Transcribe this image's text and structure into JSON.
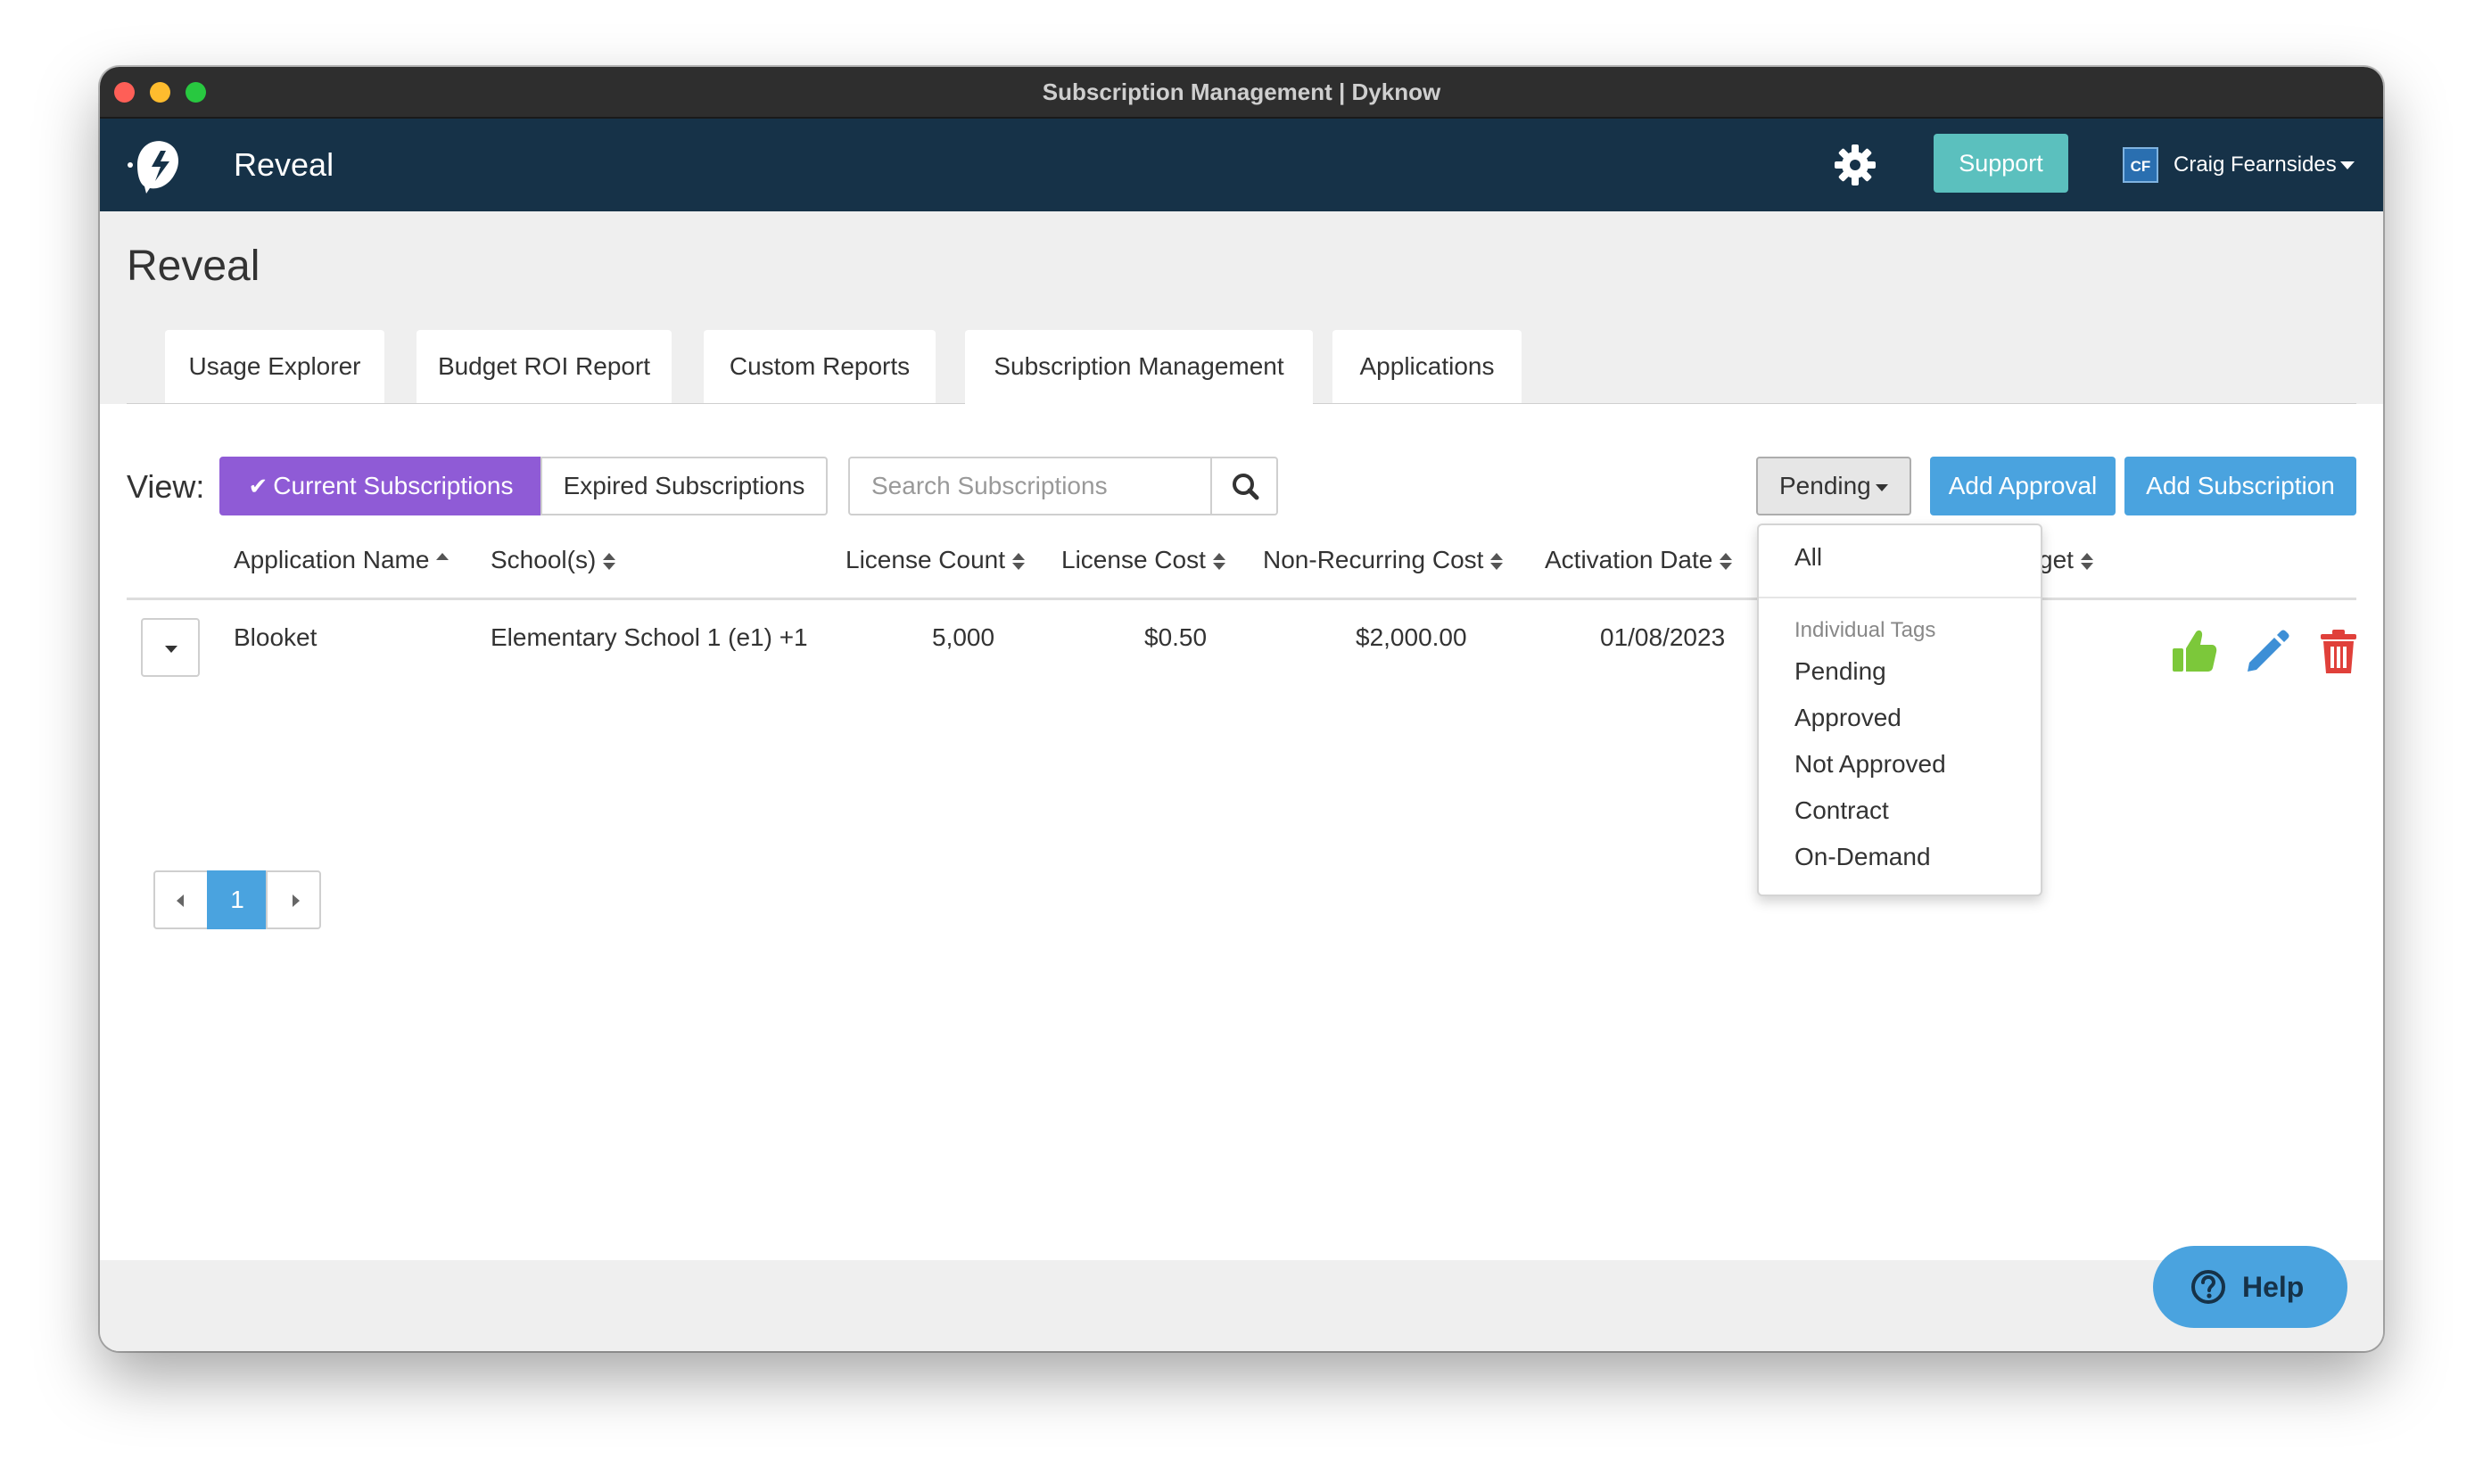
{
  "window": {
    "title": "Subscription Management | Dyknow"
  },
  "navbar": {
    "brand": "Reveal",
    "support_label": "Support",
    "user_initials": "CF",
    "user_name": "Craig Fearnsides",
    "accent": "#163248"
  },
  "page": {
    "title": "Reveal"
  },
  "tabs": [
    {
      "label": "Usage Explorer"
    },
    {
      "label": "Budget ROI Report"
    },
    {
      "label": "Custom Reports"
    },
    {
      "label": "Subscription Management",
      "active": true
    },
    {
      "label": "Applications"
    }
  ],
  "toolbar": {
    "view_label": "View:",
    "current_label": "Current Subscriptions",
    "expired_label": "Expired Subscriptions",
    "search_placeholder": "Search Subscriptions",
    "filter_value": "Pending",
    "add_approval": "Add Approval",
    "add_subscription": "Add Subscription"
  },
  "table": {
    "columns": [
      "Application Name",
      "School(s)",
      "License Count",
      "License Cost",
      "Non-Recurring Cost",
      "Activation Date",
      "get"
    ],
    "rows": [
      {
        "application": "Blooket",
        "schools": "Elementary School 1 (e1) +1",
        "license_count": "5,000",
        "license_cost": "$0.50",
        "non_recurring_cost": "$2,000.00",
        "activation_date": "01/08/2023"
      }
    ]
  },
  "dropdown": {
    "all": "All",
    "group_header": "Individual Tags",
    "items": [
      "Pending",
      "Approved",
      "Not Approved",
      "Contract",
      "On-Demand"
    ]
  },
  "pagination": {
    "current": "1"
  },
  "help": {
    "label": "Help"
  },
  "colors": {
    "current_toggle": "#8f5bd6",
    "primary_blue": "#4aa3df",
    "support_teal": "#5bc0be",
    "approve_green": "#7cc83a",
    "edit_blue": "#3d8fd6",
    "delete_red": "#e0403a"
  }
}
